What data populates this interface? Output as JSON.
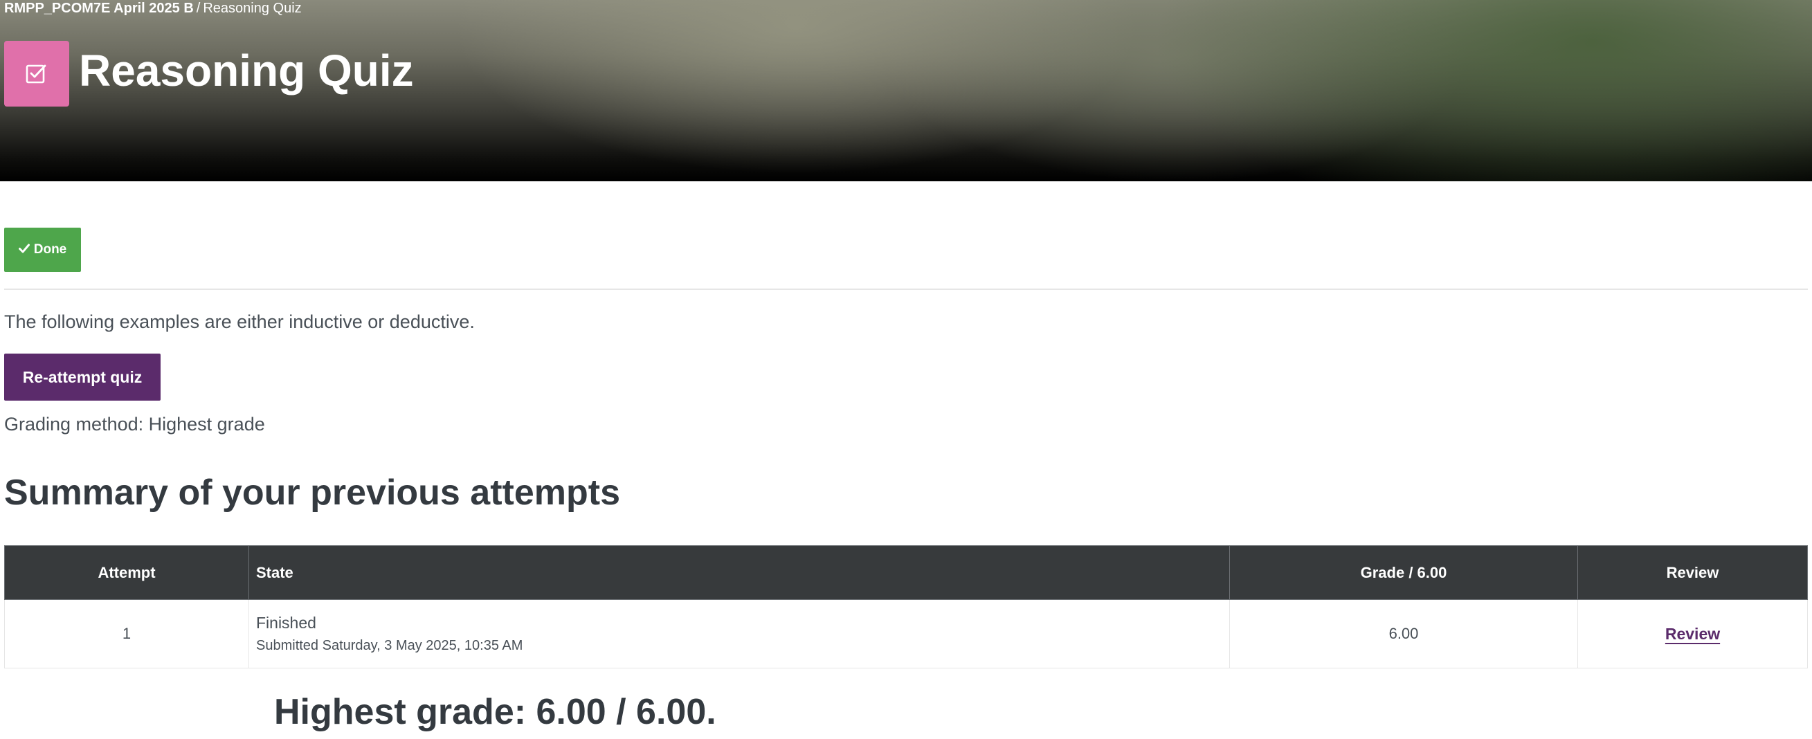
{
  "breadcrumb": {
    "course": "RMPP_PCOM7E April 2025 B",
    "separator": "/",
    "current": "Reasoning Quiz"
  },
  "header": {
    "title": "Reasoning Quiz",
    "icon": "quiz-checkbox-icon",
    "icon_color": "#e070aa"
  },
  "completion": {
    "done_label": "Done",
    "done_icon": "checkmark-icon",
    "done_color": "#4ea64b"
  },
  "intro": "The following examples are either inductive or deductive.",
  "reattempt_label": "Re-attempt quiz",
  "grading_method": "Grading method: Highest grade",
  "summary": {
    "heading": "Summary of your previous attempts",
    "columns": [
      "Attempt",
      "State",
      "Grade / 6.00",
      "Review"
    ],
    "rows": [
      {
        "attempt": "1",
        "state": "Finished",
        "submitted": "Submitted Saturday, 3 May 2025, 10:35 AM",
        "grade": "6.00",
        "review": "Review"
      }
    ]
  },
  "highest_grade": "Highest grade: 6.00 / 6.00.",
  "colors": {
    "primary": "#5b2b6b",
    "table_header": "#373a3c"
  }
}
